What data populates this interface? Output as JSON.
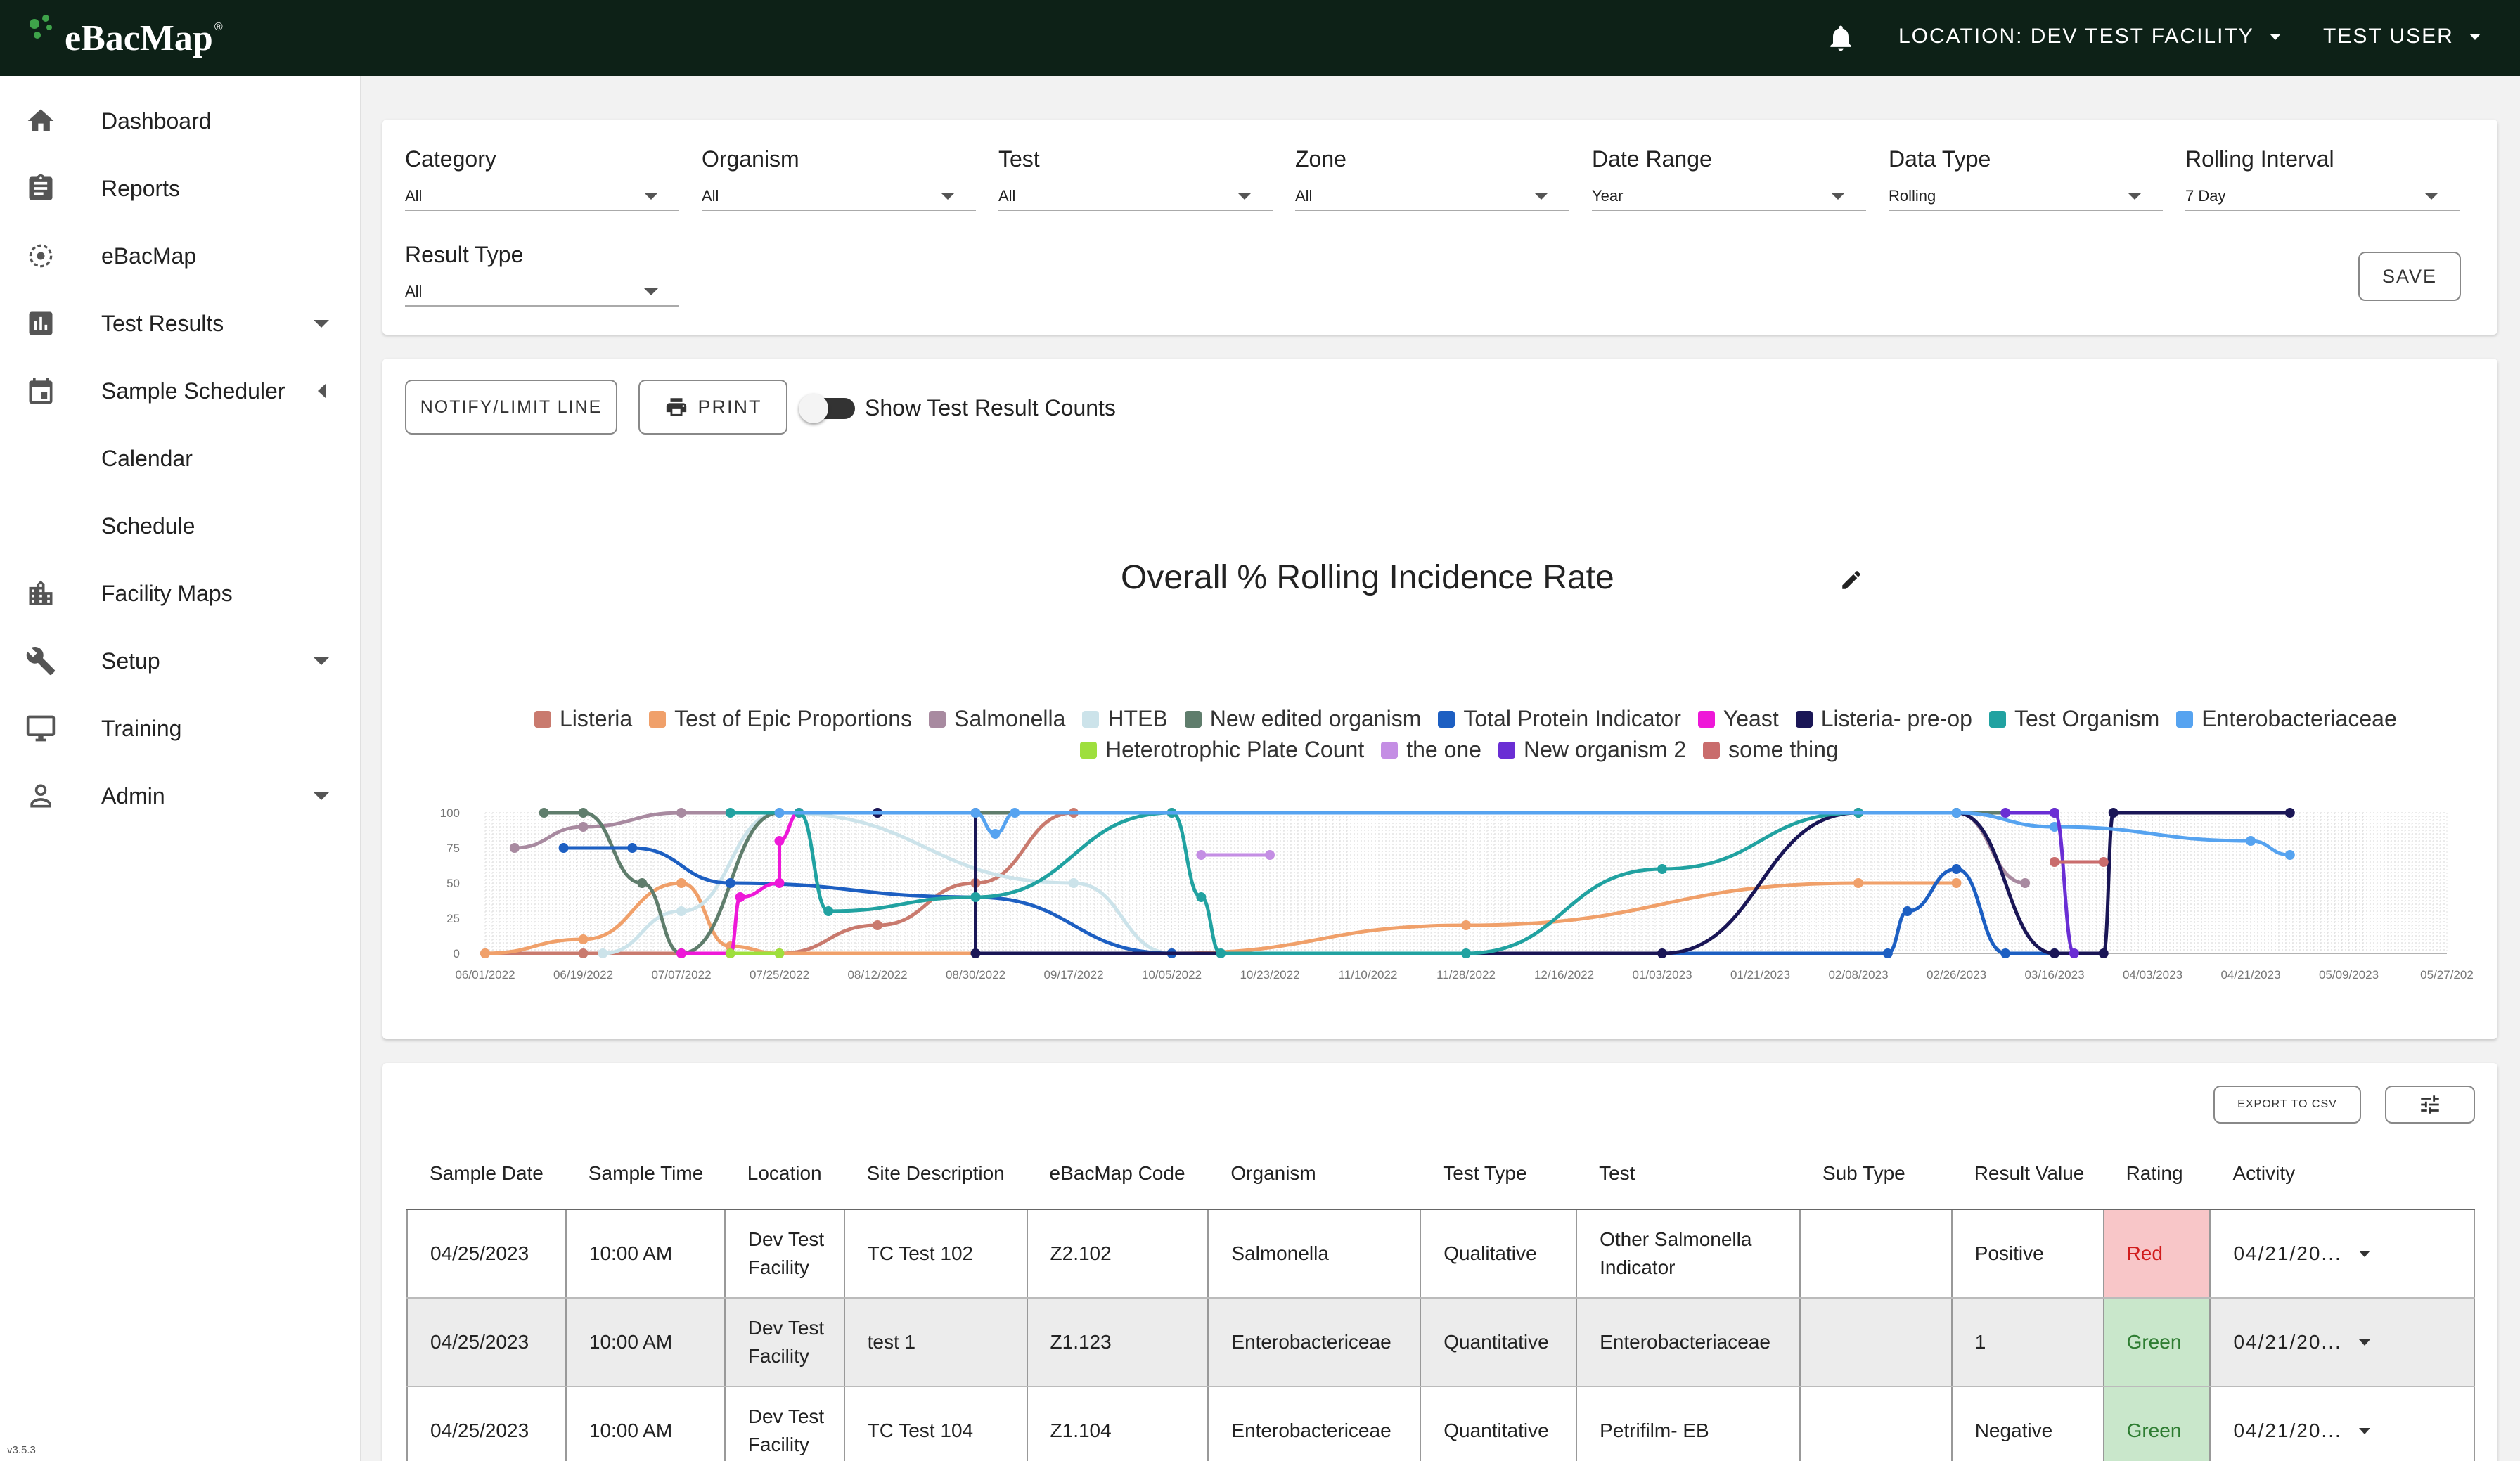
{
  "app": {
    "logo_text": "eBacMap",
    "logo_mark": "®",
    "location_label": "LOCATION: DEV TEST FACILITY",
    "user_label": "TEST USER",
    "version": "v3.5.3"
  },
  "sidebar": {
    "items": [
      {
        "label": "Dashboard",
        "icon": "home-icon"
      },
      {
        "label": "Reports",
        "icon": "clipboard-icon"
      },
      {
        "label": "eBacMap",
        "icon": "target-icon"
      },
      {
        "label": "Test Results",
        "icon": "bar-chart-icon"
      },
      {
        "label": "Sample Scheduler",
        "icon": "calendar-icon"
      },
      {
        "label": "Calendar",
        "icon": ""
      },
      {
        "label": "Schedule",
        "icon": ""
      },
      {
        "label": "Facility Maps",
        "icon": "building-icon"
      },
      {
        "label": "Setup",
        "icon": "wrench-icon"
      },
      {
        "label": "Training",
        "icon": "monitor-icon"
      },
      {
        "label": "Admin",
        "icon": "person-icon"
      }
    ]
  },
  "filters": [
    {
      "label": "Category",
      "value": "All"
    },
    {
      "label": "Organism",
      "value": "All"
    },
    {
      "label": "Test",
      "value": "All"
    },
    {
      "label": "Zone",
      "value": "All"
    },
    {
      "label": "Date Range",
      "value": "Year"
    },
    {
      "label": "Data Type",
      "value": "Rolling"
    },
    {
      "label": "Rolling Interval",
      "value": "7 Day"
    },
    {
      "label": "Result Type",
      "value": "All"
    }
  ],
  "buttons": {
    "save": "SAVE",
    "notify": "NOTIFY/LIMIT LINE",
    "print": "PRINT",
    "toggle_label": "Show Test Result Counts",
    "export": "EXPORT TO CSV"
  },
  "chart_data": {
    "type": "line",
    "title": "Overall % Rolling Incidence Rate",
    "ylim": [
      0,
      100
    ],
    "yticks": [
      "100",
      "75",
      "50",
      "25",
      "0"
    ],
    "x_ticks": [
      "06/01/2022",
      "06/19/2022",
      "07/07/2022",
      "07/25/2022",
      "08/12/2022",
      "08/30/2022",
      "09/17/2022",
      "10/05/2022",
      "10/23/2022",
      "11/10/2022",
      "11/28/2022",
      "12/16/2022",
      "01/03/2023",
      "01/21/2023",
      "02/08/2023",
      "02/26/2023",
      "03/16/2023",
      "04/03/2023",
      "04/21/2023",
      "05/09/2023",
      "05/27/202"
    ],
    "grid": true,
    "legend_position": "top",
    "series": [
      {
        "name": "Listeria",
        "color": "#c97a6e",
        "points": [
          [
            0,
            0
          ],
          [
            1,
            0
          ],
          [
            2,
            0
          ],
          [
            3,
            0
          ],
          [
            4,
            20
          ],
          [
            5,
            50
          ],
          [
            6,
            100
          ],
          [
            7,
            100
          ]
        ]
      },
      {
        "name": "Test of Epic Proportions",
        "color": "#f0a06a",
        "points": [
          [
            0,
            0
          ],
          [
            1,
            10
          ],
          [
            2,
            50
          ],
          [
            2.5,
            5
          ],
          [
            3,
            0
          ],
          [
            7,
            0
          ],
          [
            10,
            20
          ],
          [
            14,
            50
          ],
          [
            15,
            50
          ]
        ]
      },
      {
        "name": "Salmonella",
        "color": "#a88aa0",
        "points": [
          [
            0.3,
            75
          ],
          [
            1,
            90
          ],
          [
            2,
            100
          ],
          [
            4,
            100
          ],
          [
            15,
            100
          ],
          [
            15.7,
            50
          ]
        ]
      },
      {
        "name": "HTEB",
        "color": "#cce3ea",
        "points": [
          [
            1.2,
            0
          ],
          [
            2,
            30
          ],
          [
            3,
            100
          ],
          [
            6,
            50
          ],
          [
            7,
            0
          ]
        ]
      },
      {
        "name": "New edited organism",
        "color": "#5f7d6c",
        "points": [
          [
            0.6,
            100
          ],
          [
            1,
            100
          ],
          [
            1.6,
            50
          ],
          [
            2,
            0
          ],
          [
            3,
            100
          ],
          [
            16,
            100
          ]
        ]
      },
      {
        "name": "Total Protein Indicator",
        "color": "#1d5fc2",
        "points": [
          [
            0.8,
            75
          ],
          [
            1.5,
            75
          ],
          [
            2.5,
            50
          ],
          [
            5,
            40
          ],
          [
            7,
            0
          ],
          [
            14.3,
            0
          ],
          [
            14.5,
            30
          ],
          [
            15,
            60
          ],
          [
            15.5,
            0
          ],
          [
            16,
            0
          ]
        ]
      },
      {
        "name": "Yeast",
        "color": "#ee18d8",
        "points": [
          [
            2,
            0
          ],
          [
            2.5,
            0
          ],
          [
            2.6,
            40
          ],
          [
            3,
            50
          ],
          [
            3,
            80
          ],
          [
            3.2,
            100
          ]
        ]
      },
      {
        "name": "Listeria- pre-op",
        "color": "#1a1656",
        "points": [
          [
            4,
            100
          ],
          [
            5,
            100
          ],
          [
            5,
            0
          ],
          [
            12,
            0
          ],
          [
            14,
            100
          ],
          [
            15,
            100
          ],
          [
            16,
            0
          ],
          [
            16.5,
            0
          ],
          [
            16.6,
            100
          ],
          [
            18.4,
            100
          ]
        ]
      },
      {
        "name": "Test Organism",
        "color": "#21a2a1",
        "points": [
          [
            2.5,
            100
          ],
          [
            3.2,
            100
          ],
          [
            3.5,
            30
          ],
          [
            5,
            40
          ],
          [
            7,
            100
          ],
          [
            7.3,
            40
          ],
          [
            7.5,
            0
          ],
          [
            10,
            0
          ],
          [
            12,
            60
          ],
          [
            14,
            100
          ],
          [
            15,
            100
          ]
        ]
      },
      {
        "name": "Enterobacteriaceae",
        "color": "#56a3f0",
        "points": [
          [
            3,
            100
          ],
          [
            5,
            100
          ],
          [
            5.2,
            85
          ],
          [
            5.4,
            100
          ],
          [
            15,
            100
          ],
          [
            16,
            90
          ],
          [
            18,
            80
          ],
          [
            18.4,
            70
          ]
        ]
      },
      {
        "name": "Heterotrophic Plate Count",
        "color": "#9edf3d",
        "points": [
          [
            2.5,
            0
          ],
          [
            3,
            0
          ]
        ]
      },
      {
        "name": "the one",
        "color": "#c48ee4",
        "points": [
          [
            7.3,
            70
          ],
          [
            8,
            70
          ]
        ]
      },
      {
        "name": "New organism 2",
        "color": "#6a2ed4",
        "points": [
          [
            15.5,
            100
          ],
          [
            16,
            100
          ],
          [
            16.2,
            0
          ]
        ]
      },
      {
        "name": "some thing",
        "color": "#c96c6c",
        "points": [
          [
            16,
            65
          ],
          [
            16.5,
            65
          ]
        ]
      }
    ]
  },
  "table": {
    "columns": [
      "Sample Date",
      "Sample Time",
      "Location",
      "Site Description",
      "eBacMap Code",
      "Organism",
      "Test Type",
      "Test",
      "Sub Type",
      "Result Value",
      "Rating",
      "Activity"
    ],
    "rows": [
      {
        "date": "04/25/2023",
        "time": "10:00 AM",
        "location": "Dev Test Facility",
        "site": "TC Test 102",
        "code": "Z2.102",
        "organism": "Salmonella",
        "test_type": "Qualitative",
        "test": "Other Salmonella Indicator",
        "sub_type": "",
        "result": "Positive",
        "rating": "Red",
        "activity": "04/21/20..."
      },
      {
        "date": "04/25/2023",
        "time": "10:00 AM",
        "location": "Dev Test Facility",
        "site": "test 1",
        "code": "Z1.123",
        "organism": "Enterobactericeae",
        "test_type": "Quantitative",
        "test": "Enterobacteriaceae",
        "sub_type": "",
        "result": "1",
        "rating": "Green",
        "activity": "04/21/20..."
      },
      {
        "date": "04/25/2023",
        "time": "10:00 AM",
        "location": "Dev Test Facility",
        "site": "TC Test 104",
        "code": "Z1.104",
        "organism": "Enterobactericeae",
        "test_type": "Quantitative",
        "test": "Petrifilm- EB",
        "sub_type": "",
        "result": "Negative",
        "rating": "Green",
        "activity": "04/21/20..."
      }
    ]
  },
  "colors": {
    "topbar": "#0d2117",
    "accent_green": "#3ea34a",
    "rating_red_bg": "#f8c6c8",
    "rating_green_bg": "#c9e7cb"
  }
}
